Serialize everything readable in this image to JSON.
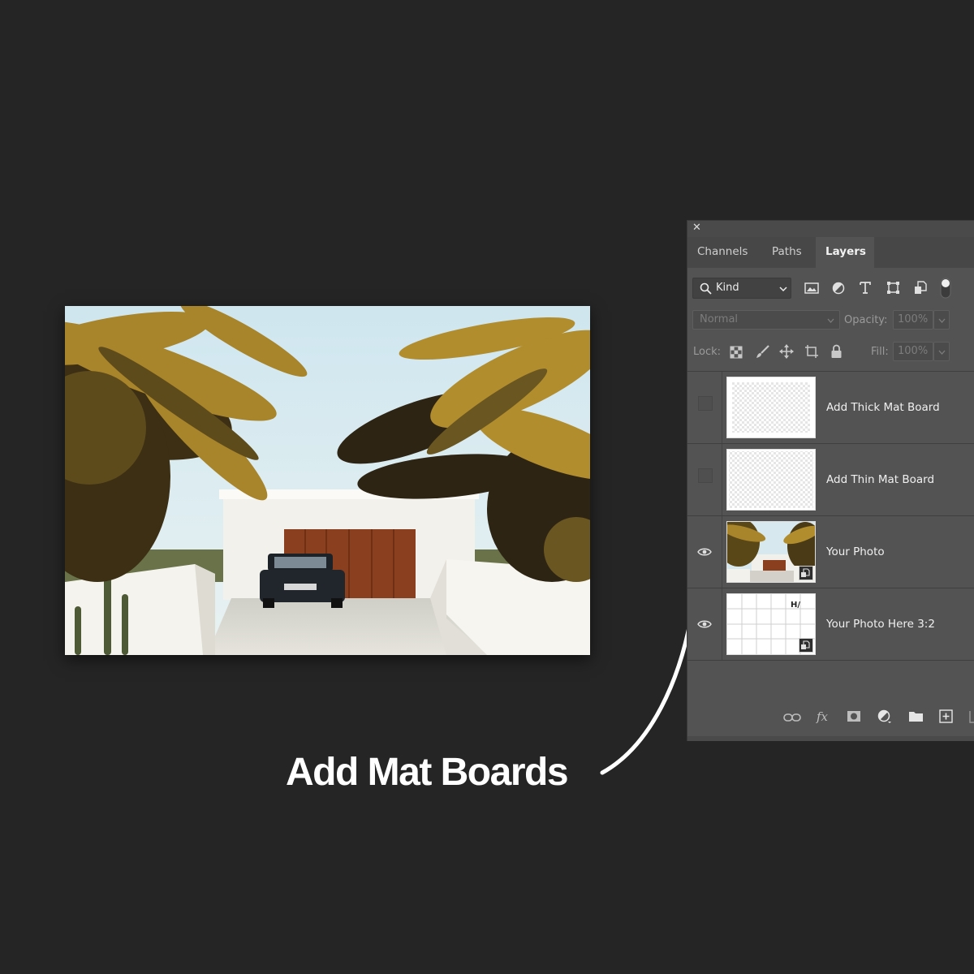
{
  "caption": "Add Mat Boards",
  "photo": {
    "subject": "palm-trees-white-garage-vintage-car"
  },
  "layers_panel": {
    "close_icon": "close-icon",
    "tabs": [
      {
        "label": "Channels",
        "active": false
      },
      {
        "label": "Paths",
        "active": false
      },
      {
        "label": "Layers",
        "active": true
      }
    ],
    "filter": {
      "label": "Kind"
    },
    "blend_mode": "Normal",
    "opacity_label": "Opacity:",
    "opacity_value": "100%",
    "lock_label": "Lock:",
    "fill_label": "Fill:",
    "fill_value": "100%",
    "layers": [
      {
        "name": "Add Thick Mat Board",
        "visible": false,
        "thumb": "transparent"
      },
      {
        "name": "Add Thin Mat Board",
        "visible": false,
        "thumb": "transparent"
      },
      {
        "name": "Your Photo",
        "visible": true,
        "thumb": "photo",
        "smart_object": true
      },
      {
        "name": "Your Photo Here 3:2",
        "visible": true,
        "thumb": "grid",
        "smart_object": true,
        "thumb_mark": "H/"
      }
    ]
  },
  "colors": {
    "background": "#252525",
    "panel": "#535353",
    "caption": "#ffffff",
    "arrow": "#ffffff"
  }
}
